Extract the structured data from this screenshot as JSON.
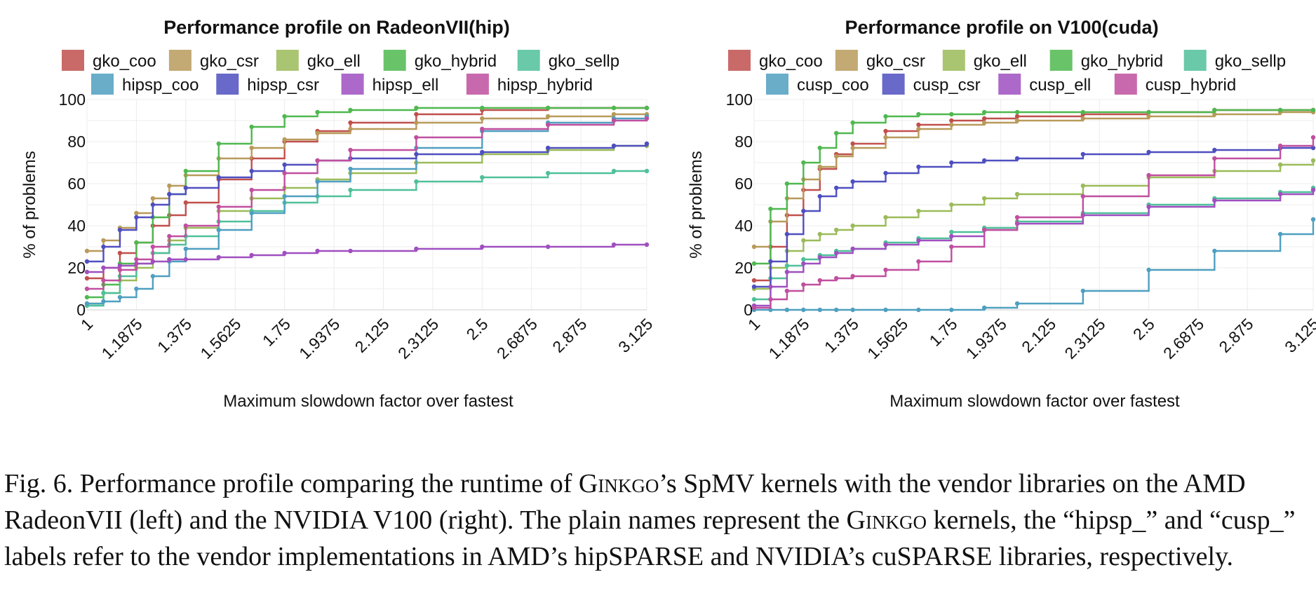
{
  "charts": {
    "tick_labels": [
      "1",
      "1.1875",
      "1.375",
      "1.5625",
      "1.75",
      "1.9375",
      "2.125",
      "2.3125",
      "2.5",
      "2.6875",
      "2.875",
      "3.125"
    ],
    "y_tick_labels": [
      "0",
      "20",
      "40",
      "60",
      "80",
      "100"
    ],
    "colors": {
      "gko_coo": "#c0504d",
      "gko_csr": "#b89a5a",
      "gko_ell": "#9bbb59",
      "gko_hybrid": "#4fb84f",
      "gko_sellp": "#4fc09a",
      "vendor_coo": "#4f9fc0",
      "vendor_csr": "#4f4fc0",
      "vendor_ell": "#9f4fc0",
      "vendor_hybrid": "#c04f9f"
    }
  },
  "chart_data": [
    {
      "type": "line",
      "title": "Performance profile on RadeonVII(hip)",
      "xlabel": "Maximum slowdown factor over fastest",
      "ylabel": "% of problems",
      "xlim": [
        1,
        3.125
      ],
      "ylim": [
        0,
        100
      ],
      "grid": true,
      "legend": "top",
      "series": [
        {
          "name": "gko_coo",
          "x": [
            1,
            1.0625,
            1.125,
            1.1875,
            1.25,
            1.3125,
            1.375,
            1.5,
            1.625,
            1.75,
            1.875,
            2,
            2.25,
            2.5,
            2.75,
            3,
            3.125
          ],
          "values": [
            15,
            20,
            27,
            32,
            40,
            45,
            51,
            62,
            72,
            80,
            85,
            89,
            93,
            95,
            96,
            96,
            96
          ]
        },
        {
          "name": "gko_csr",
          "x": [
            1,
            1.0625,
            1.125,
            1.1875,
            1.25,
            1.3125,
            1.375,
            1.5,
            1.625,
            1.75,
            1.875,
            2,
            2.25,
            2.5,
            2.75,
            3,
            3.125
          ],
          "values": [
            28,
            33,
            39,
            46,
            53,
            59,
            64,
            72,
            77,
            81,
            84,
            86,
            89,
            91,
            92,
            93,
            93
          ]
        },
        {
          "name": "gko_ell",
          "x": [
            1,
            1.0625,
            1.125,
            1.1875,
            1.25,
            1.3125,
            1.375,
            1.5,
            1.625,
            1.75,
            1.875,
            2,
            2.25,
            2.5,
            2.75,
            3,
            3.125
          ],
          "values": [
            3,
            8,
            14,
            20,
            27,
            33,
            39,
            47,
            53,
            58,
            62,
            65,
            70,
            74,
            76,
            78,
            78
          ]
        },
        {
          "name": "gko_hybrid",
          "x": [
            1,
            1.0625,
            1.125,
            1.1875,
            1.25,
            1.3125,
            1.375,
            1.5,
            1.625,
            1.75,
            1.875,
            2,
            2.25,
            2.5,
            2.75,
            3,
            3.125
          ],
          "values": [
            6,
            12,
            22,
            32,
            44,
            55,
            66,
            79,
            87,
            92,
            94,
            95,
            96,
            96,
            96,
            96,
            96
          ]
        },
        {
          "name": "gko_sellp",
          "x": [
            1,
            1.0625,
            1.125,
            1.1875,
            1.25,
            1.3125,
            1.375,
            1.5,
            1.625,
            1.75,
            1.875,
            2,
            2.25,
            2.5,
            2.75,
            3,
            3.125
          ],
          "values": [
            2,
            8,
            16,
            22,
            27,
            31,
            35,
            42,
            47,
            51,
            54,
            57,
            61,
            63,
            65,
            66,
            66
          ]
        },
        {
          "name": "hipsp_coo",
          "x": [
            1,
            1.0625,
            1.125,
            1.1875,
            1.25,
            1.3125,
            1.375,
            1.5,
            1.625,
            1.75,
            1.875,
            2,
            2.25,
            2.5,
            2.75,
            3,
            3.125
          ],
          "values": [
            3,
            4,
            6,
            10,
            16,
            23,
            29,
            38,
            46,
            54,
            61,
            67,
            77,
            85,
            89,
            91,
            92
          ]
        },
        {
          "name": "hipsp_csr",
          "x": [
            1,
            1.0625,
            1.125,
            1.1875,
            1.25,
            1.3125,
            1.375,
            1.5,
            1.625,
            1.75,
            1.875,
            2,
            2.25,
            2.5,
            2.75,
            3,
            3.125
          ],
          "values": [
            23,
            30,
            38,
            44,
            50,
            55,
            58,
            63,
            66,
            69,
            71,
            72,
            74,
            75,
            77,
            78,
            79
          ]
        },
        {
          "name": "hipsp_ell",
          "x": [
            1,
            1.0625,
            1.125,
            1.1875,
            1.25,
            1.3125,
            1.375,
            1.5,
            1.625,
            1.75,
            1.875,
            2,
            2.25,
            2.5,
            2.75,
            3,
            3.125
          ],
          "values": [
            18,
            20,
            21,
            22,
            23,
            24,
            24,
            25,
            26,
            27,
            28,
            28,
            29,
            30,
            30,
            31,
            31
          ]
        },
        {
          "name": "hipsp_hybrid",
          "x": [
            1,
            1.0625,
            1.125,
            1.1875,
            1.25,
            1.3125,
            1.375,
            1.5,
            1.625,
            1.75,
            1.875,
            2,
            2.25,
            2.5,
            2.75,
            3,
            3.125
          ],
          "values": [
            10,
            14,
            19,
            24,
            30,
            35,
            40,
            49,
            57,
            65,
            71,
            76,
            82,
            86,
            88,
            90,
            91
          ]
        }
      ]
    },
    {
      "type": "line",
      "title": "Performance profile on V100(cuda)",
      "xlabel": "Maximum slowdown factor over fastest",
      "ylabel": "% of problems",
      "xlim": [
        1,
        3.125
      ],
      "ylim": [
        0,
        100
      ],
      "grid": true,
      "legend": "top",
      "series": [
        {
          "name": "gko_coo",
          "x": [
            1,
            1.0625,
            1.125,
            1.1875,
            1.25,
            1.3125,
            1.375,
            1.5,
            1.625,
            1.75,
            1.875,
            2,
            2.25,
            2.5,
            2.75,
            3,
            3.125
          ],
          "values": [
            14,
            30,
            45,
            57,
            67,
            74,
            79,
            85,
            88,
            90,
            91,
            92,
            93,
            94,
            95,
            95,
            95
          ]
        },
        {
          "name": "gko_csr",
          "x": [
            1,
            1.0625,
            1.125,
            1.1875,
            1.25,
            1.3125,
            1.375,
            1.5,
            1.625,
            1.75,
            1.875,
            2,
            2.25,
            2.5,
            2.75,
            3,
            3.125
          ],
          "values": [
            30,
            42,
            53,
            62,
            68,
            73,
            77,
            82,
            86,
            88,
            89,
            90,
            91,
            92,
            93,
            94,
            94
          ]
        },
        {
          "name": "gko_ell",
          "x": [
            1,
            1.0625,
            1.125,
            1.1875,
            1.25,
            1.3125,
            1.375,
            1.5,
            1.625,
            1.75,
            1.875,
            2,
            2.25,
            2.5,
            2.75,
            3,
            3.125
          ],
          "values": [
            10,
            20,
            28,
            33,
            36,
            38,
            40,
            44,
            47,
            50,
            53,
            55,
            59,
            63,
            66,
            69,
            71
          ]
        },
        {
          "name": "gko_hybrid",
          "x": [
            1,
            1.0625,
            1.125,
            1.1875,
            1.25,
            1.3125,
            1.375,
            1.5,
            1.625,
            1.75,
            1.875,
            2,
            2.25,
            2.5,
            2.75,
            3,
            3.125
          ],
          "values": [
            22,
            48,
            60,
            70,
            77,
            84,
            89,
            92,
            93,
            93,
            94,
            94,
            94,
            94,
            95,
            95,
            95
          ]
        },
        {
          "name": "gko_sellp",
          "x": [
            1,
            1.0625,
            1.125,
            1.1875,
            1.25,
            1.3125,
            1.375,
            1.5,
            1.625,
            1.75,
            1.875,
            2,
            2.25,
            2.5,
            2.75,
            3,
            3.125
          ],
          "values": [
            5,
            15,
            21,
            24,
            26,
            28,
            29,
            32,
            34,
            37,
            39,
            42,
            46,
            50,
            53,
            56,
            58
          ]
        },
        {
          "name": "cusp_coo",
          "x": [
            1,
            1.0625,
            1.125,
            1.1875,
            1.25,
            1.3125,
            1.375,
            1.5,
            1.625,
            1.75,
            1.875,
            2,
            2.25,
            2.5,
            2.75,
            3,
            3.125
          ],
          "values": [
            0,
            0,
            0,
            0,
            0,
            0,
            0,
            0,
            0,
            0,
            1,
            3,
            9,
            19,
            28,
            36,
            43
          ]
        },
        {
          "name": "cusp_csr",
          "x": [
            1,
            1.0625,
            1.125,
            1.1875,
            1.25,
            1.3125,
            1.375,
            1.5,
            1.625,
            1.75,
            1.875,
            2,
            2.25,
            2.5,
            2.75,
            3,
            3.125
          ],
          "values": [
            11,
            23,
            36,
            47,
            54,
            58,
            61,
            65,
            68,
            70,
            71,
            72,
            74,
            75,
            76,
            77,
            77
          ]
        },
        {
          "name": "cusp_ell",
          "x": [
            1,
            1.0625,
            1.125,
            1.1875,
            1.25,
            1.3125,
            1.375,
            1.5,
            1.625,
            1.75,
            1.875,
            2,
            2.25,
            2.5,
            2.75,
            3,
            3.125
          ],
          "values": [
            2,
            11,
            18,
            22,
            25,
            27,
            29,
            31,
            33,
            35,
            38,
            41,
            45,
            49,
            52,
            55,
            57
          ]
        },
        {
          "name": "cusp_hybrid",
          "x": [
            1,
            1.0625,
            1.125,
            1.1875,
            1.25,
            1.3125,
            1.375,
            1.5,
            1.625,
            1.75,
            1.875,
            2,
            2.25,
            2.5,
            2.75,
            3,
            3.125
          ],
          "values": [
            1,
            5,
            9,
            12,
            14,
            15,
            16,
            19,
            23,
            30,
            38,
            44,
            54,
            64,
            72,
            78,
            82
          ]
        }
      ]
    }
  ],
  "caption": {
    "fig_label": "Fig. 6.",
    "part1": " Performance profile comparing the runtime of ",
    "ginkgo1": "Ginkgo",
    "part2": "’s SpMV kernels with the vendor libraries on the AMD RadeonVII (left) and the NVIDIA V100 (right). The plain names represent the ",
    "ginkgo2": "Ginkgo",
    "part3": " kernels, the “hipsp_” and “cusp_” labels refer to the vendor implementations in AMD’s hipSPARSE and NVIDIA’s cuSPARSE libraries, respectively."
  }
}
